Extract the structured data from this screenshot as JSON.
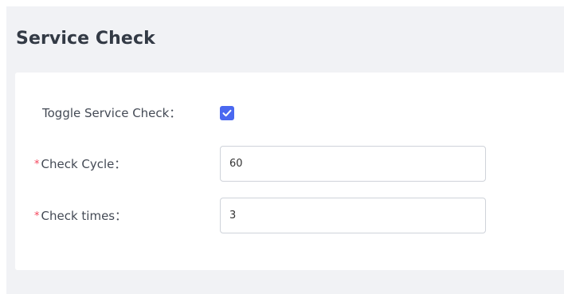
{
  "section": {
    "title": "Service Check"
  },
  "form": {
    "toggle": {
      "label": "Toggle Service Check：",
      "checked": true
    },
    "check_cycle": {
      "required_mark": "*",
      "label": "Check Cycle：",
      "value": "60"
    },
    "check_times": {
      "required_mark": "*",
      "label": "Check times：",
      "value": "3"
    }
  },
  "colors": {
    "accent": "#4a68f0",
    "required": "#f5455c",
    "panel_background": "#f1f2f5"
  }
}
